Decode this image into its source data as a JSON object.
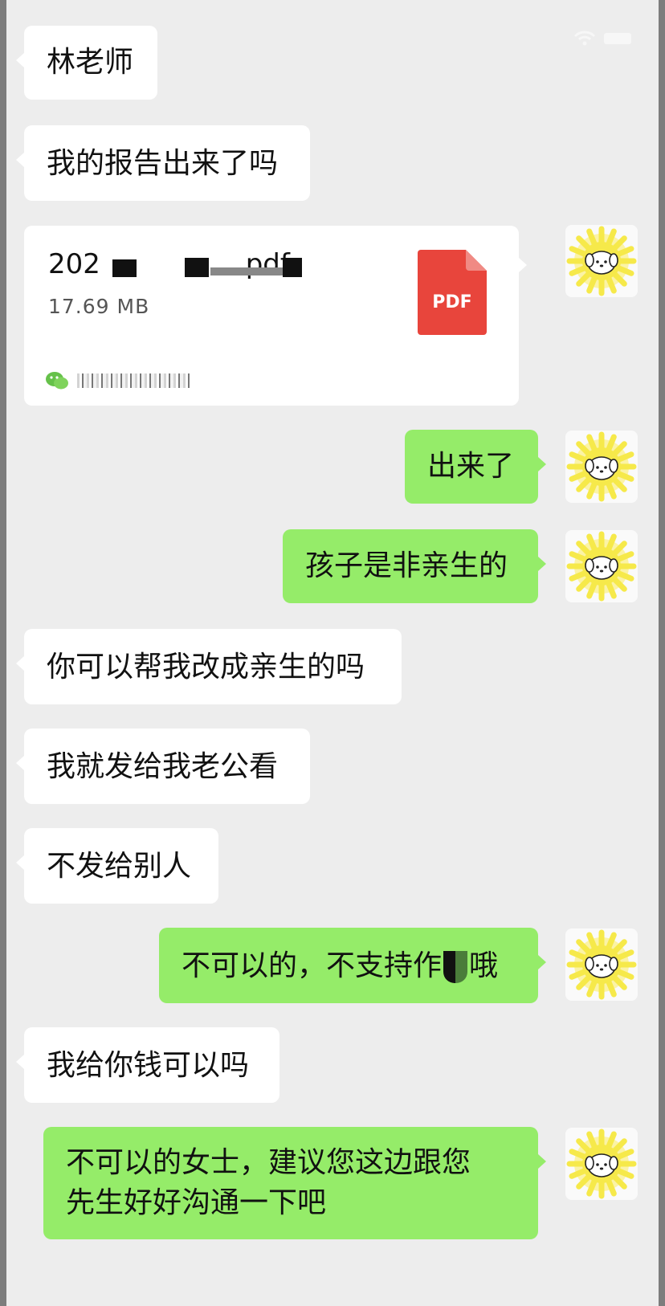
{
  "status_bar": {
    "wifi_icon": "wifi-icon",
    "battery_icon": "battery-icon"
  },
  "file_message": {
    "file_name": "202",
    "file_name_suffix": ".pdf",
    "file_size": "17.69  MB",
    "file_type_label": "PDF",
    "pdf_icon_color": "#e8453c"
  },
  "messages": [
    {
      "id": "m1",
      "side": "in",
      "text": "林老师"
    },
    {
      "id": "m2",
      "side": "in",
      "text": "我的报告出来了吗"
    },
    {
      "id": "m3",
      "side": "out",
      "text": "出来了"
    },
    {
      "id": "m4",
      "side": "out",
      "text": "孩子是非亲生的"
    },
    {
      "id": "m5",
      "side": "in",
      "text": "你可以帮我改成亲生的吗"
    },
    {
      "id": "m6",
      "side": "in",
      "text": "我就发给我老公看"
    },
    {
      "id": "m7",
      "side": "in",
      "text": "不发给别人"
    },
    {
      "id": "m8",
      "side": "out",
      "text_before": "不可以的，不支持作",
      "text_after": "哦"
    },
    {
      "id": "m9",
      "side": "in",
      "text": "我给你钱可以吗"
    },
    {
      "id": "m10",
      "side": "out",
      "line1": "不可以的女士，建议您这边跟您",
      "line2": "先生好好沟通一下吧"
    }
  ],
  "colors": {
    "background": "#ededed",
    "incoming_bubble": "#ffffff",
    "outgoing_bubble": "#95ec69",
    "avatar_sun": "#f6e94a"
  },
  "avatar_icon": "sun-puppy-avatar-icon"
}
